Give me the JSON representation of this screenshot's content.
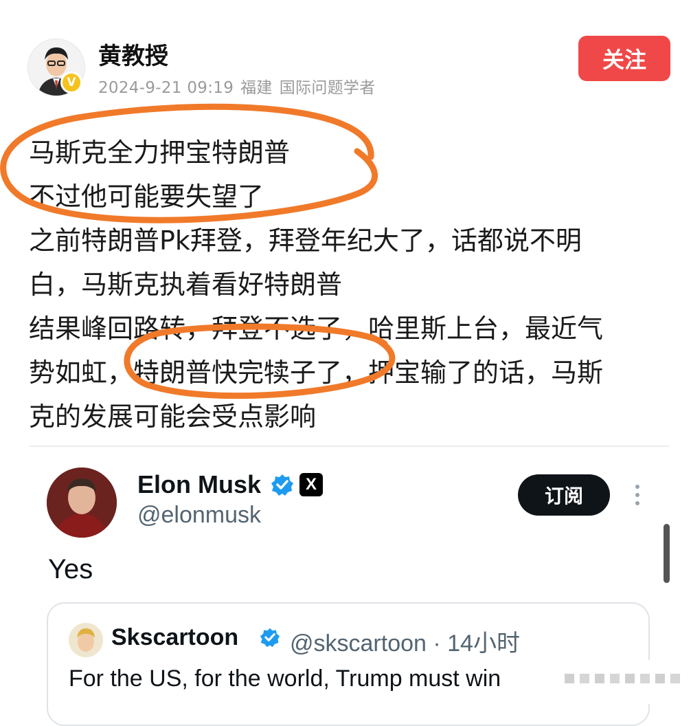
{
  "author": {
    "name": "黄教授",
    "date": "2024-9-21 09:19",
    "location": "福建",
    "title": "国际问题学者",
    "follow_label": "关注"
  },
  "post": {
    "lines": [
      "马斯克全力押宝特朗普",
      "不过他可能要失望了",
      "之前特朗普Pk拜登，拜登年纪大了，话都说不明",
      "白，马斯克执着看好特朗普",
      "结果峰回路转，拜登不选了，哈里斯上台，最近气",
      "势如虹，特朗普快完犊子了，押宝输了的话，马斯",
      "克的发展可能会受点影响"
    ]
  },
  "embedded_tweet": {
    "name": "Elon Musk",
    "handle": "@elonmusk",
    "x_badge": "X",
    "subscribe_label": "订阅",
    "text": "Yes",
    "quoted": {
      "name": "Skscartoon",
      "handle_time": "@skscartoon · 14小时",
      "text": "For the US, for the world, Trump must win"
    }
  },
  "colors": {
    "follow_button": "#f04848",
    "annotation": "#f07a2a",
    "verified_badge": "#f6c21c",
    "twitter_blue": "#1d9bf0"
  },
  "icons": [
    "verified-icon",
    "blue-check-icon",
    "x-logo-icon",
    "more-vertical-icon"
  ]
}
